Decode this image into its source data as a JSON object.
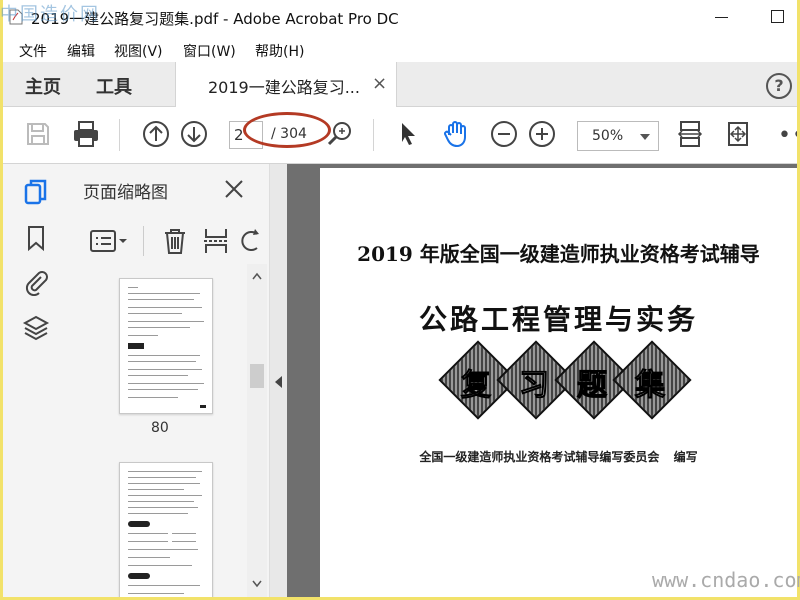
{
  "window": {
    "title": "2019一建公路复习题集.pdf - Adobe Acrobat Pro DC"
  },
  "menu": {
    "items": [
      {
        "label": "文件"
      },
      {
        "label": "编辑"
      },
      {
        "label": "视图(V)"
      },
      {
        "label": "窗口(W)"
      },
      {
        "label": "帮助(H)"
      }
    ]
  },
  "tabs": {
    "home": "主页",
    "tools": "工具",
    "document": "2019一建公路复习...",
    "close_symbol": "×",
    "help_symbol": "?"
  },
  "toolbar": {
    "current_page": "2",
    "total_pages": "/ 304",
    "zoom": "50%",
    "more": "•••"
  },
  "thumbnails": {
    "title": "页面缩略图",
    "page_label": "80"
  },
  "document": {
    "heading": "2019 年版全国一级建造师执业资格考试辅导",
    "subject": "公路工程管理与实务",
    "review_chars": [
      "复",
      "习",
      "题",
      "集"
    ],
    "author": "全国一级建造师执业资格考试辅导编写委员会 编写"
  },
  "watermarks": {
    "top": "中国造价网",
    "bottom": "www.cndao.com"
  },
  "colors": {
    "annotation": "#b43a24",
    "border": "#f2e26a"
  }
}
